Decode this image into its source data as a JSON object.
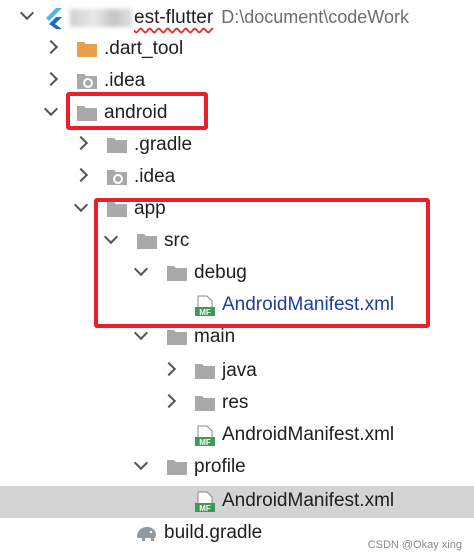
{
  "project": {
    "name_visible": "est-flutter",
    "path": "D:\\document\\codeWork"
  },
  "tree": {
    "dart_tool": ".dart_tool",
    "idea_root": ".idea",
    "android": "android",
    "gradle": ".gradle",
    "idea_android": ".idea",
    "app": "app",
    "src": "src",
    "debug": "debug",
    "debug_manifest": "AndroidManifest.xml",
    "main": "main",
    "java": "java",
    "res": "res",
    "main_manifest": "AndroidManifest.xml",
    "profile": "profile",
    "profile_manifest": "AndroidManifest.xml",
    "build_gradle": "build.gradle"
  },
  "icons": {
    "manifest_badge": "MF"
  },
  "watermark": "CSDN @Okay xing",
  "colors": {
    "folder_gray": "#a9a9a9",
    "folder_orange": "#e8a04d",
    "highlight_red": "#e8202a",
    "selected_row": "#d4d4d4",
    "link_blue": "#1c3f9e",
    "manifest_green": "#3d9a50"
  }
}
